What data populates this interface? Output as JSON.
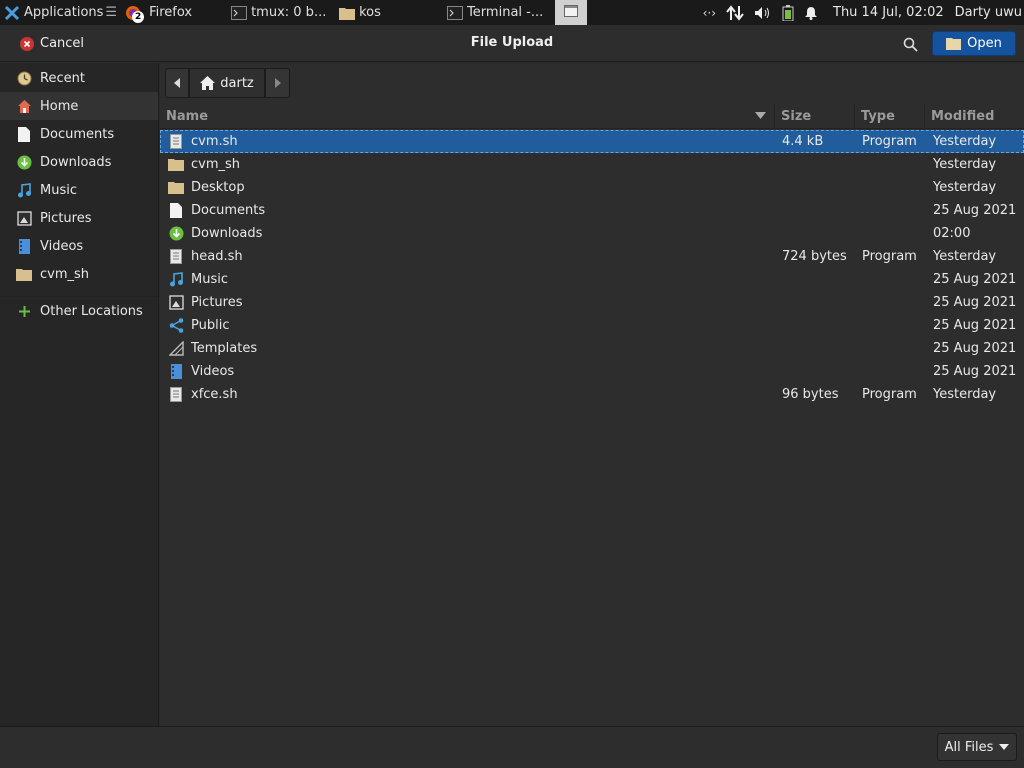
{
  "panel": {
    "apps_label": "Applications",
    "apps_suffix": "☰",
    "firefox_label": "Firefox",
    "firefox_badge": "2",
    "tasks": [
      {
        "label": "tmux: 0 b...",
        "icon": "terminal-icon"
      },
      {
        "label": "kos",
        "icon": "folder-icon"
      },
      {
        "label": "Terminal -...",
        "icon": "terminal-icon"
      }
    ],
    "clock": "Thu 14 Jul, 02:02",
    "user": "Darty uwu"
  },
  "dialog": {
    "title": "File Upload",
    "cancel_label": "Cancel",
    "open_label": "Open",
    "accent": "#15539e"
  },
  "sidebar": {
    "items": [
      {
        "label": "Recent",
        "icon": "clock-icon"
      },
      {
        "label": "Home",
        "icon": "home-icon"
      },
      {
        "label": "Documents",
        "icon": "document-icon"
      },
      {
        "label": "Downloads",
        "icon": "download-icon"
      },
      {
        "label": "Music",
        "icon": "music-icon"
      },
      {
        "label": "Pictures",
        "icon": "pictures-icon"
      },
      {
        "label": "Videos",
        "icon": "video-icon"
      },
      {
        "label": "cvm_sh",
        "icon": "folder-icon"
      },
      {
        "label": "Other Locations",
        "icon": "plus-icon"
      }
    ],
    "selected": "Home"
  },
  "pathbar": {
    "current": "dartz"
  },
  "columns": {
    "name": "Name",
    "size": "Size",
    "type": "Type",
    "modified": "Modified"
  },
  "files": [
    {
      "name": "cvm.sh",
      "size": "4.4 kB",
      "type": "Program",
      "modified": "Yesterday",
      "icon": "script-file-icon",
      "selected": true
    },
    {
      "name": "cvm_sh",
      "size": "",
      "type": "",
      "modified": "Yesterday",
      "icon": "folder-icon"
    },
    {
      "name": "Desktop",
      "size": "",
      "type": "",
      "modified": "Yesterday",
      "icon": "folder-icon"
    },
    {
      "name": "Documents",
      "size": "",
      "type": "",
      "modified": "25 Aug 2021",
      "icon": "document-icon"
    },
    {
      "name": "Downloads",
      "size": "",
      "type": "",
      "modified": "02:00",
      "icon": "download-icon"
    },
    {
      "name": "head.sh",
      "size": "724 bytes",
      "type": "Program",
      "modified": "Yesterday",
      "icon": "script-file-icon"
    },
    {
      "name": "Music",
      "size": "",
      "type": "",
      "modified": "25 Aug 2021",
      "icon": "music-icon"
    },
    {
      "name": "Pictures",
      "size": "",
      "type": "",
      "modified": "25 Aug 2021",
      "icon": "pictures-icon"
    },
    {
      "name": "Public",
      "size": "",
      "type": "",
      "modified": "25 Aug 2021",
      "icon": "share-icon"
    },
    {
      "name": "Templates",
      "size": "",
      "type": "",
      "modified": "25 Aug 2021",
      "icon": "templates-icon"
    },
    {
      "name": "Videos",
      "size": "",
      "type": "",
      "modified": "25 Aug 2021",
      "icon": "video-icon"
    },
    {
      "name": "xfce.sh",
      "size": "96 bytes",
      "type": "Program",
      "modified": "Yesterday",
      "icon": "script-file-icon"
    }
  ],
  "footer": {
    "filter_label": "All Files"
  }
}
